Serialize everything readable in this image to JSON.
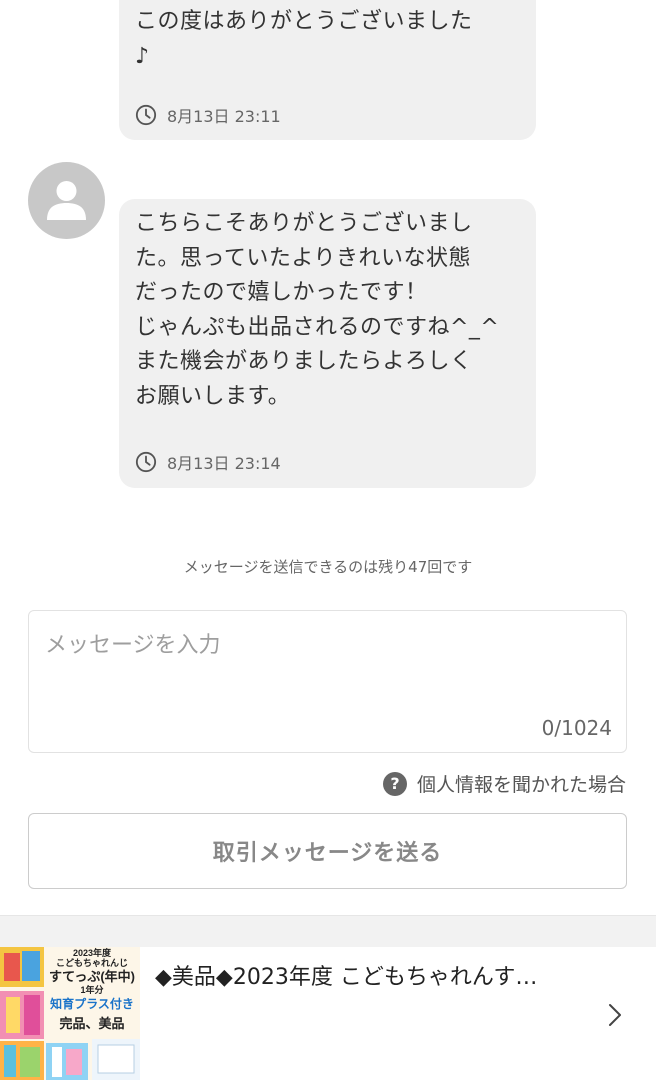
{
  "messages": [
    {
      "text": "この度はありがとうございました\n♪",
      "time": "8月13日 23:11"
    },
    {
      "text": "こちらこそありがとうございまし\nた。思っていたよりきれいな状態\nだったので嬉しかったです！\nじゃんぷも出品されるのですね^_^\nまた機会がありましたらよろしく\nお願いします。",
      "time": "8月13日 23:14"
    }
  ],
  "remaining_notice": "メッセージを送信できるのは残り47回です",
  "compose": {
    "placeholder": "メッセージを入力",
    "char_count": "0/1024"
  },
  "privacy_link": "個人情報を聞かれた場合",
  "send_button": "取引メッセージを送る",
  "item": {
    "title": "◆美品◆2023年度 こどもちゃれんす…",
    "thumb": {
      "year": "2023年度",
      "brand": "こどもちゃれんじ",
      "name": "すてっぷ(年中)",
      "period": "1年分",
      "extra": "知育プラス付き",
      "condition": "完品、美品"
    }
  },
  "colors": {
    "bubble_bg": "#f0f0f0",
    "avatar": "#c8c8c8",
    "extra_text": "#1a73c9"
  }
}
